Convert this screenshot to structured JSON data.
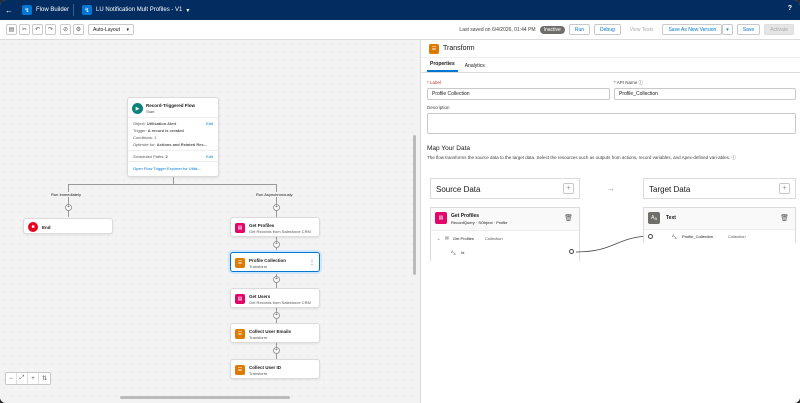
{
  "topbar": {
    "app_name": "Flow Builder",
    "flow_name": "LU Notification Mult Profiles - V1",
    "help": "?"
  },
  "toolbar": {
    "layout_select": "Auto-Layout",
    "last_saved": "Last saved on 6/4/2026, 01:44 PM",
    "status": "Inactive",
    "run": "Run",
    "debug": "Debug",
    "view_tests": "View Tests",
    "save_as": "Save As New Version",
    "save": "Save",
    "activate": "Activate"
  },
  "canvas": {
    "start": {
      "title": "Record-Triggered Flow",
      "sub": "Start",
      "object_label": "Object:",
      "object_value": "Utilisation Alert",
      "edit": "Edit",
      "trigger_label": "Trigger:",
      "trigger_value": "A record is created",
      "conditions": "Conditions: 1",
      "optimize_label": "Optimize for:",
      "optimize_value": "Actions and Related Rec...",
      "scheduled_label": "Scheduled Paths:",
      "scheduled_value": "2",
      "explorer_link": "Open Flow Trigger Explorer for Utilis..."
    },
    "path_left": "Run Immediately",
    "path_right": "Run Asynchronously",
    "end": "End",
    "nodes": [
      {
        "title": "Get Profiles",
        "sub": "Get Records from Salesforce CRM",
        "color": "#c23934"
      },
      {
        "title": "Profile Collection",
        "sub": "Transform",
        "color": "#dd7a01"
      },
      {
        "title": "Get Users",
        "sub": "Get Records from Salesforce CRM",
        "color": "#c23934"
      },
      {
        "title": "Collect User Emails",
        "sub": "Transform",
        "color": "#dd7a01"
      },
      {
        "title": "Collect User ID",
        "sub": "Transform",
        "color": "#dd7a01"
      }
    ]
  },
  "panel": {
    "title": "Transform",
    "tab_properties": "Properties",
    "tab_analytics": "Analytics",
    "label_label": "* Label",
    "label_value": "Profile Collection",
    "api_label": "* API Name",
    "api_value": "Profile_Collection",
    "description_label": "Description",
    "map_title": "Map Your Data",
    "map_desc": "The flow transforms the source data to the target data. Select the resources such as outputs from actions, record variables, and Apex-defined vari-ables.",
    "source_header": "Source Data",
    "target_header": "Target Data",
    "source": {
      "title": "Get Profiles",
      "meta": "RecordQuery · SObject · Profile",
      "child": "Get Profiles",
      "child_type": "Collection",
      "field": "Id"
    },
    "target": {
      "title": "Text",
      "field": "Profile_Collection",
      "field_type": "Collection"
    }
  }
}
